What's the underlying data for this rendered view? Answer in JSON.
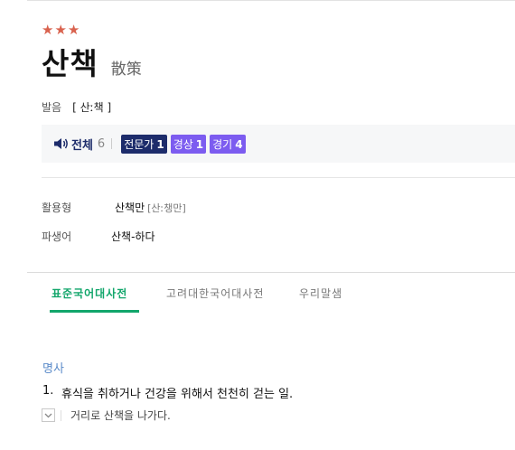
{
  "entry": {
    "stars": "★★★",
    "headword": "산책",
    "hanja": "散策",
    "pronunciation_label": "발음",
    "pronunciation_value": "[ 산ː책 ]"
  },
  "frequency": {
    "total_label": "전체",
    "total_count": "6",
    "tags": [
      {
        "label": "전문가",
        "count": "1"
      },
      {
        "label": "경상",
        "count": "1"
      },
      {
        "label": "경기",
        "count": "4"
      }
    ]
  },
  "forms": {
    "inflection_label": "활용형",
    "inflection_value": "산책만",
    "inflection_pron": "[산ː챙만]",
    "derivative_label": "파생어",
    "derivative_value": "산책-하다"
  },
  "tabs": [
    "표준국어대사전",
    "고려대한국어대사전",
    "우리말샘"
  ],
  "definition": {
    "part_of_speech": "명사",
    "number": "1.",
    "text": "휴식을 취하거나 건강을 위해서 천천히 걷는 일.",
    "example": "거리로 산책을 나가다."
  },
  "colors": {
    "star": "#d9624e",
    "expert_tag": "#1d2c6b",
    "region_tag": "#7c5cf0",
    "active_tab": "#12a66b",
    "part_of_speech": "#5b8bc9"
  }
}
